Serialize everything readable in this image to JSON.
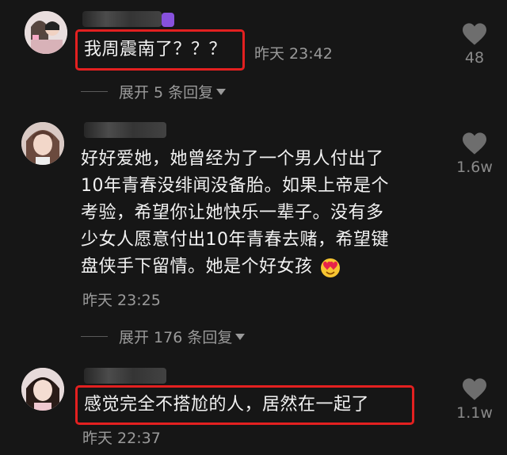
{
  "comments": [
    {
      "text": "我周震南了？？？",
      "time": "昨天 23:42",
      "replies": "展开 5 条回复",
      "likes": "48"
    },
    {
      "lines": [
        "好好爱她，她曾经为了一个男人付出了",
        "10年青春没绯闻没备胎。如果上帝是个",
        "考验，希望你让她快乐一辈子。没有多",
        "少女人愿意付出10年青春去赌，希望键",
        "盘侠手下留情。她是个好女孩"
      ],
      "time": "昨天 23:25",
      "replies": "展开 176 条回复",
      "likes": "1.6w"
    },
    {
      "text": "感觉完全不搭尬的人，居然在一起了",
      "time": "昨天 22:37",
      "likes": "1.1w"
    }
  ],
  "icons": {
    "like": "heart-icon",
    "expand": "caret-down-icon",
    "emoji": "heart-eyes-emoji"
  },
  "colors": {
    "background": "#161616",
    "highlight": "#e32020",
    "muted": "#9a9a9a"
  }
}
